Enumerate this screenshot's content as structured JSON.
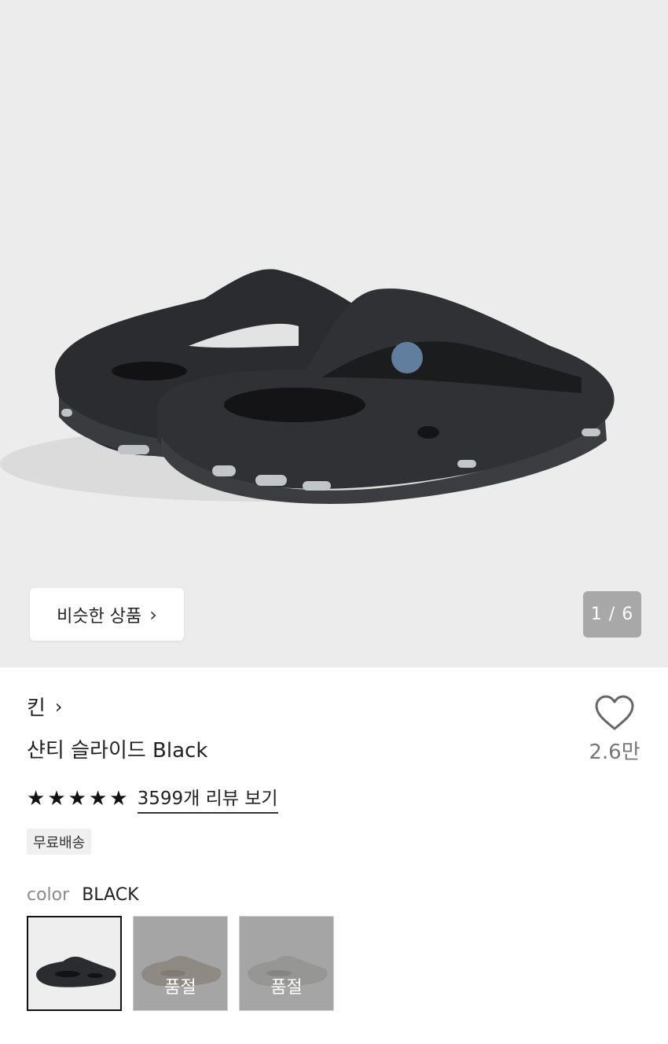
{
  "gallery": {
    "similar_button_label": "비슷한 상품",
    "counter": "1 / 6",
    "current_index": 1,
    "total": 6
  },
  "product": {
    "brand": "킨",
    "title": "샨티 슬라이드 Black",
    "wishlist_count": "2.6만",
    "rating_stars": 5,
    "review_link": "3599개 리뷰 보기",
    "shipping_badge": "무료배송"
  },
  "color": {
    "label": "color",
    "selected": "BLACK",
    "options": [
      {
        "name": "black",
        "status": ""
      },
      {
        "name": "taupe",
        "status": "품절"
      },
      {
        "name": "grey",
        "status": "품절"
      }
    ]
  }
}
